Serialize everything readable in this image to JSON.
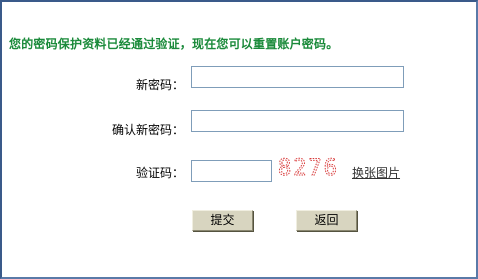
{
  "notice": "您的密码保护资料已经通过验证，现在您可以重置账户密码。",
  "form": {
    "new_password_label": "新密码：",
    "new_password_value": "",
    "confirm_password_label": "确认新密码：",
    "confirm_password_value": "",
    "captcha_label": "验证码：",
    "captcha_value": "",
    "captcha_image_text": "8276",
    "change_image_link": "换张图片"
  },
  "buttons": {
    "submit_label": "提交",
    "back_label": "返回"
  },
  "colors": {
    "notice_green": "#1a8a3a",
    "captcha_red": "#d83a3a",
    "button_face": "#d8d5c0",
    "input_border": "#7f9db9"
  }
}
